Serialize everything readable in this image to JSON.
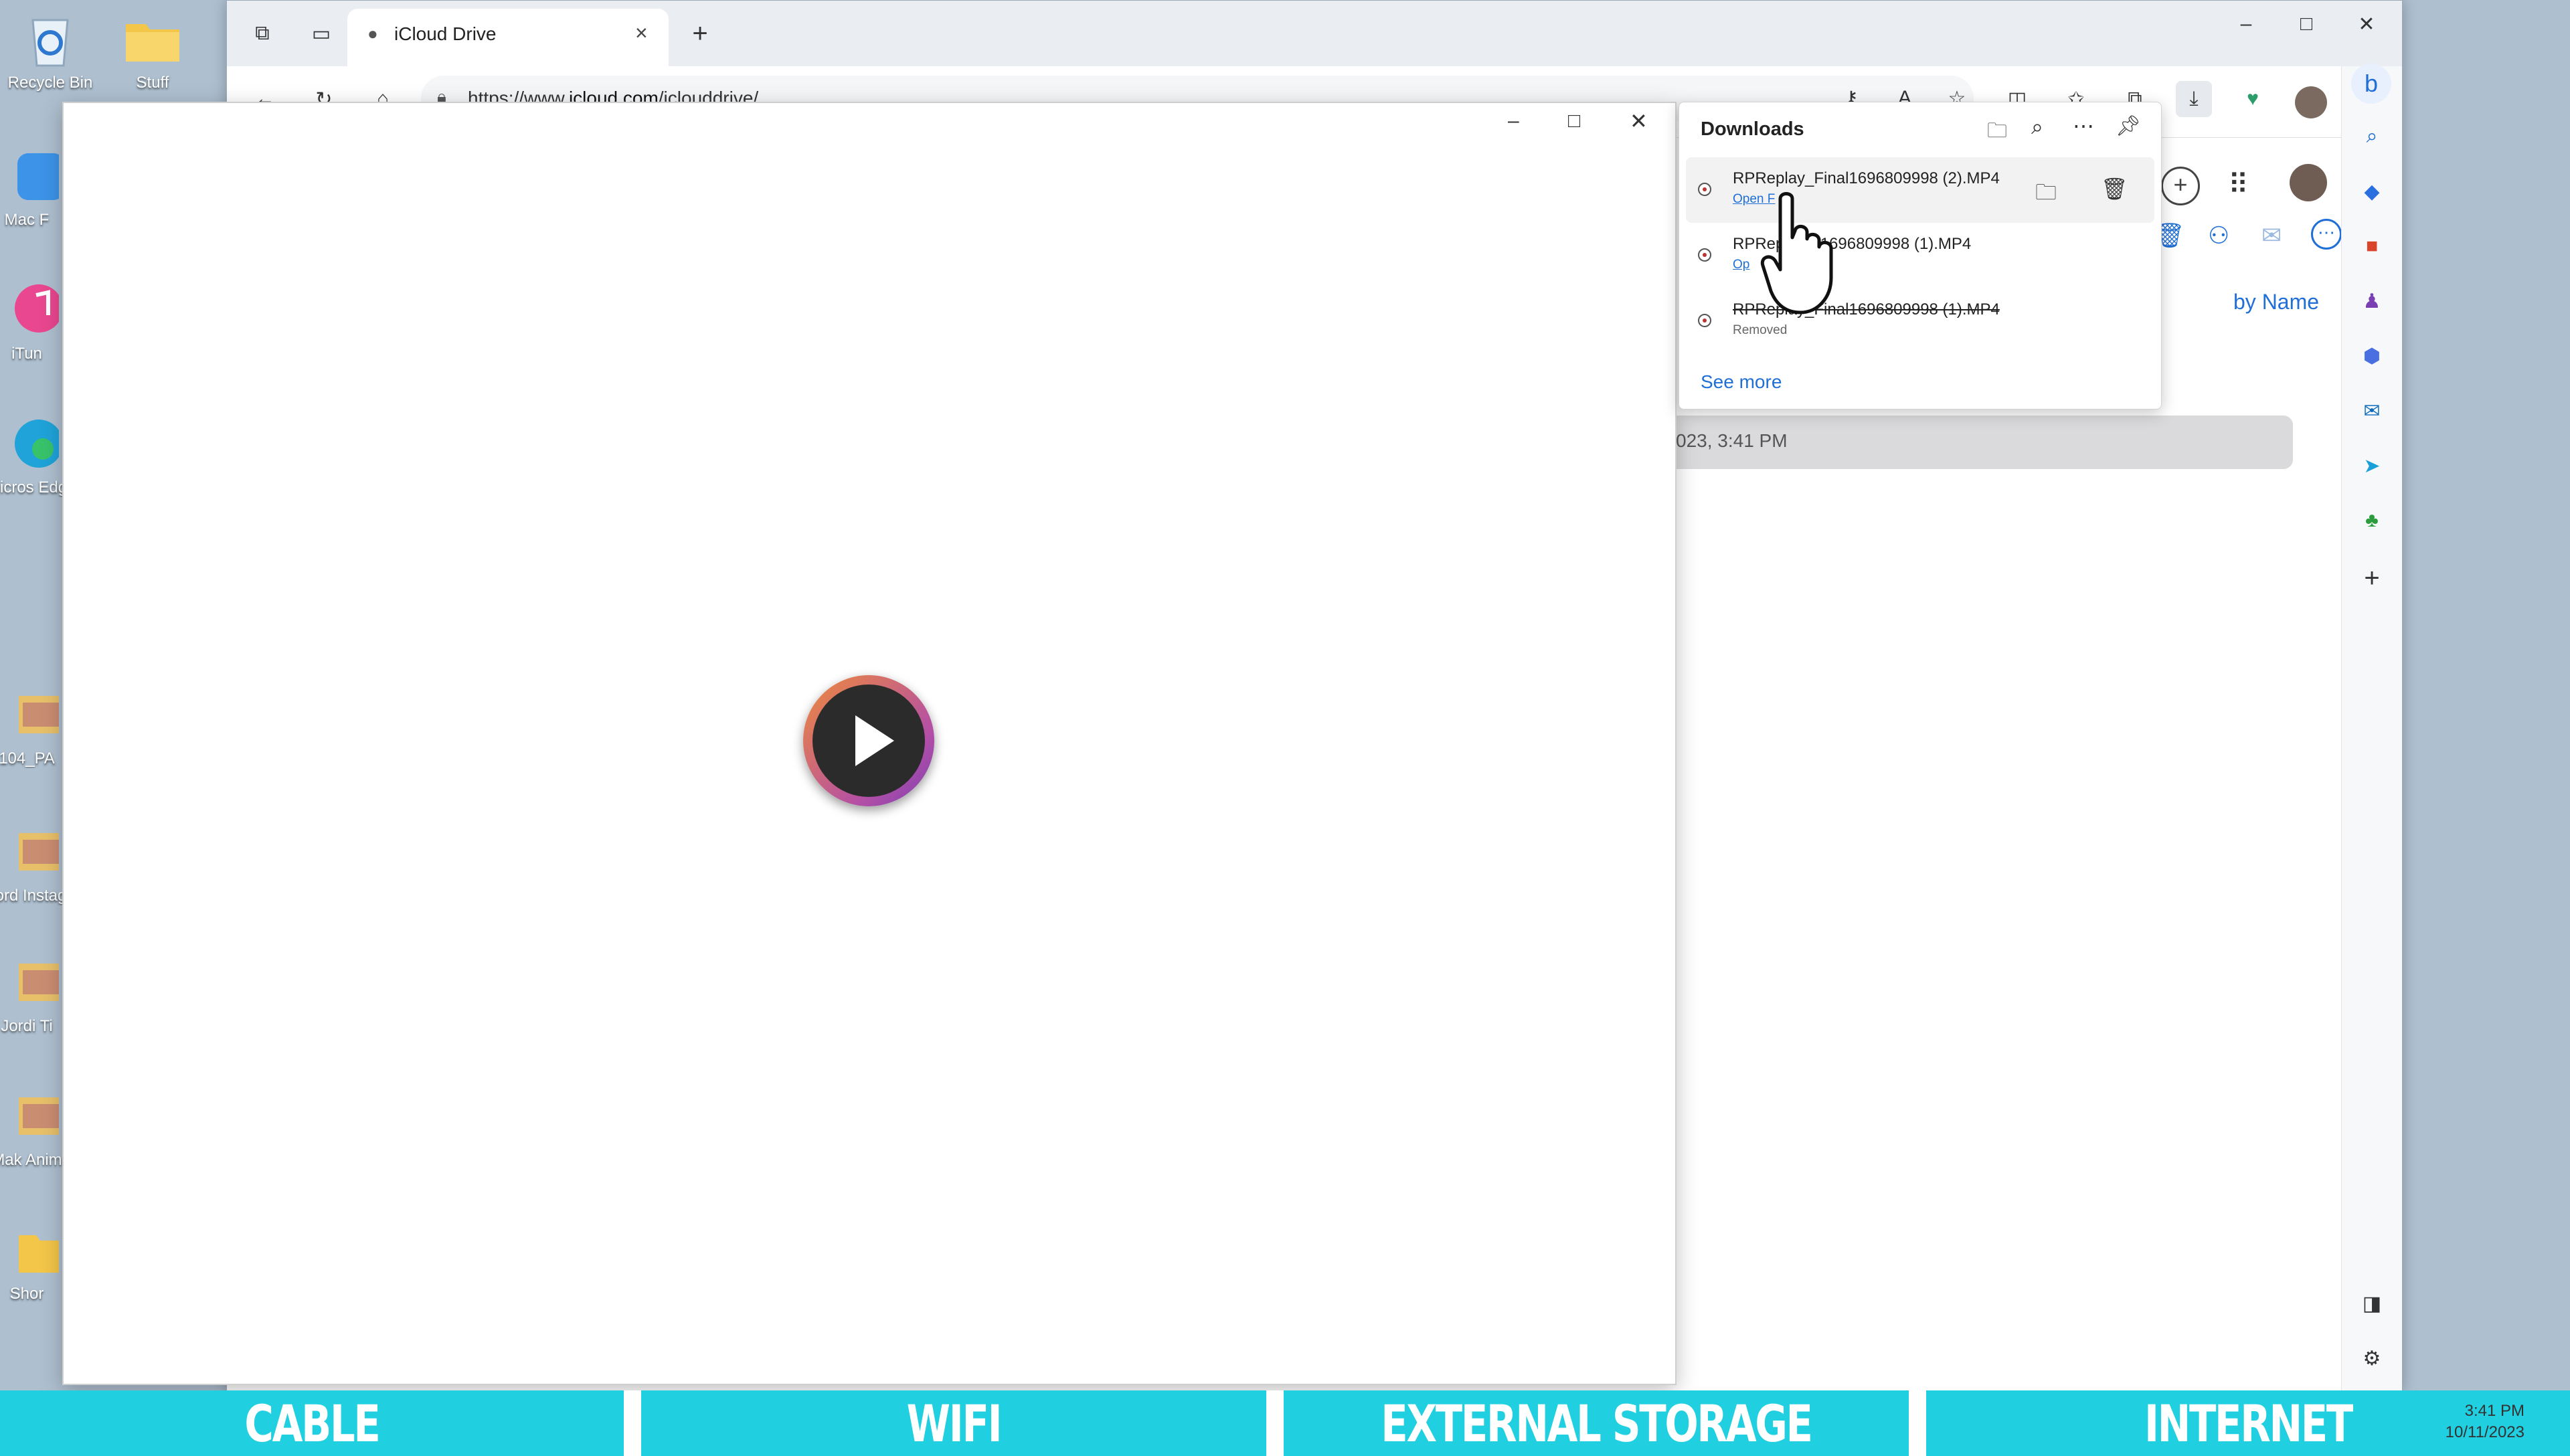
{
  "desktop": {
    "icons": [
      {
        "label": "Recycle Bin"
      },
      {
        "label": "Stuff"
      },
      {
        "label": "Mac F"
      },
      {
        "label": "iTun"
      },
      {
        "label": "Micros Edg"
      },
      {
        "label": "104_PA"
      },
      {
        "label": "Jord Instag"
      },
      {
        "label": "Jordi Ti"
      },
      {
        "label": "Mak Anim"
      },
      {
        "label": "Shor"
      }
    ]
  },
  "browser": {
    "tab_title": "iCloud Drive",
    "url_prefix": "https://www.",
    "url_domain": "icloud.com",
    "url_path": "/iclouddrive/"
  },
  "icloud": {
    "sort_label": "by Name",
    "row_date": "023, 3:41 PM"
  },
  "downloads": {
    "title": "Downloads",
    "items": [
      {
        "name": "RPReplay_Final1696809998 (2).MP4",
        "sub": "Open F"
      },
      {
        "name": "RPRep        1696809998 (1).MP4",
        "sub": "Op"
      },
      {
        "name": "RPReplay_Final1696809998 (1).MP4",
        "sub": "Removed"
      }
    ],
    "see_more": "See more"
  },
  "banner": {
    "segments": [
      "CABLE",
      "WIFI",
      "EXTERNAL STORAGE",
      "INTERNET"
    ]
  },
  "taskbar": {
    "time": "3:41 PM",
    "date": "10/11/2023"
  },
  "colors": {
    "accent": "#1f6fd6",
    "banner": "#20cfe0"
  }
}
